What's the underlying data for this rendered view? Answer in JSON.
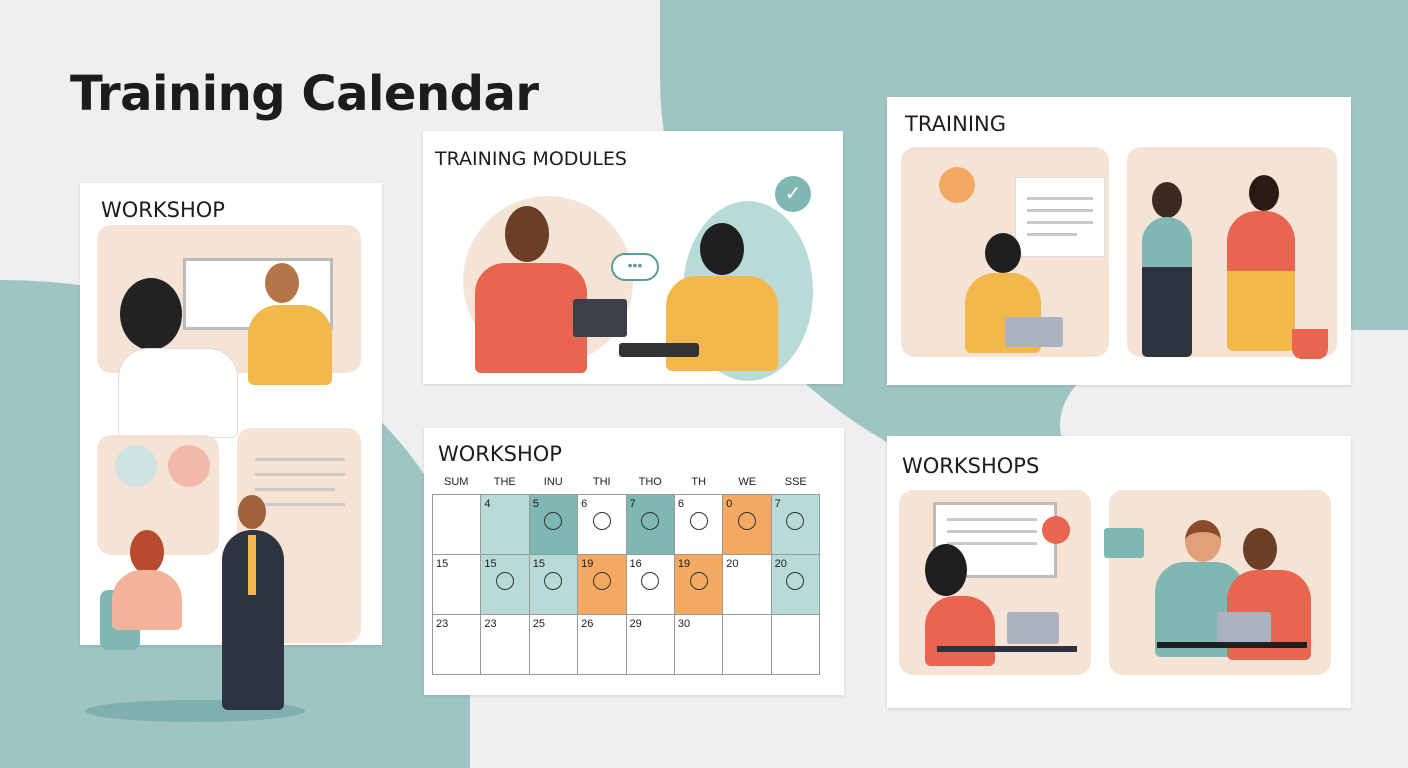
{
  "title": "Training Calendar",
  "cards": {
    "workshop_left": {
      "title": "WORKSHOP"
    },
    "training_modules": {
      "title": "TRAINING MODULES"
    },
    "training": {
      "title": "TRAINING"
    },
    "calendar": {
      "title": "WORKSHOP"
    },
    "workshops": {
      "title": "WORKSHOPS"
    }
  },
  "calendar": {
    "days": [
      "SUM",
      "THE",
      "INU",
      "THI",
      "THO",
      "TH",
      "WE",
      "SSE"
    ],
    "rows": [
      [
        {
          "d": "",
          "c": "w"
        },
        {
          "d": "4",
          "c": "lt"
        },
        {
          "d": "5",
          "c": "dt",
          "i": 1
        },
        {
          "d": "6",
          "c": "w",
          "i": 1
        },
        {
          "d": "7",
          "c": "dt",
          "i": 1
        },
        {
          "d": "6",
          "c": "w",
          "i": 1
        },
        {
          "d": "0",
          "c": "or",
          "i": 1
        },
        {
          "d": "7",
          "c": "lt",
          "i": 1
        }
      ],
      [
        {
          "d": "15",
          "c": "w"
        },
        {
          "d": "15",
          "c": "lt",
          "i": 1
        },
        {
          "d": "15",
          "c": "lt",
          "i": 1
        },
        {
          "d": "19",
          "c": "or",
          "i": 1
        },
        {
          "d": "16",
          "c": "w",
          "i": 1
        },
        {
          "d": "19",
          "c": "or",
          "i": 1
        },
        {
          "d": "20",
          "c": "w"
        },
        {
          "d": "20",
          "c": "lt",
          "i": 1
        }
      ],
      [
        {
          "d": "23",
          "c": "w"
        },
        {
          "d": "23",
          "c": "w"
        },
        {
          "d": "25",
          "c": "w"
        },
        {
          "d": "26",
          "c": "w"
        },
        {
          "d": "29",
          "c": "w"
        },
        {
          "d": "30",
          "c": "w"
        },
        {
          "d": "",
          "c": "w"
        },
        {
          "d": "",
          "c": "w"
        }
      ]
    ]
  },
  "colors": {
    "teal": "#9fc5c3",
    "orange": "#f3a962",
    "coral": "#e8664f",
    "yellow": "#f2b84b"
  }
}
